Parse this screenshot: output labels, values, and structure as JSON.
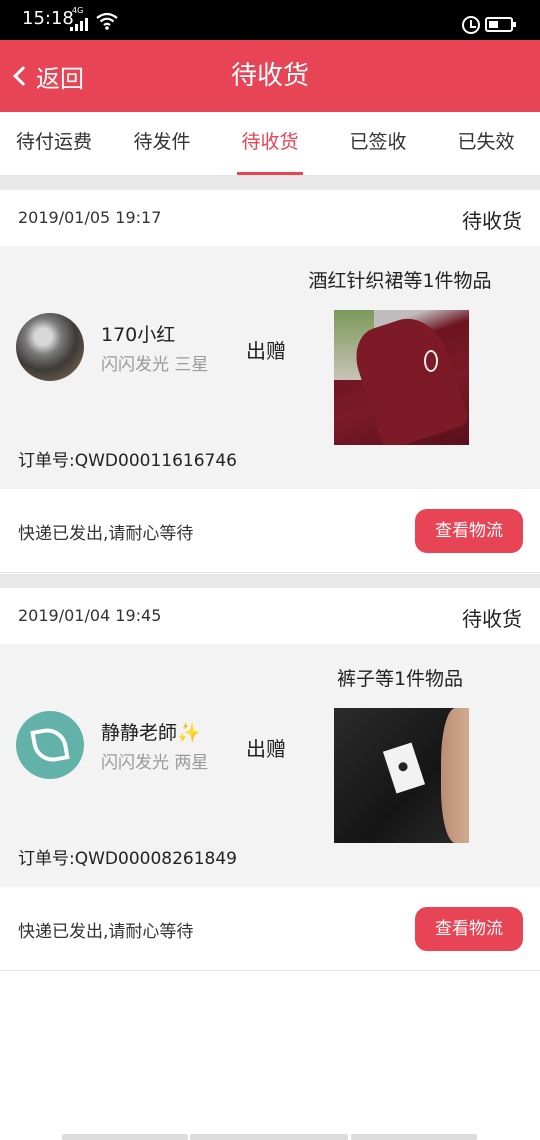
{
  "status_bar": {
    "time": "15:18",
    "network": "4G",
    "icons": [
      "signal-icon",
      "wifi-icon",
      "alarm-icon",
      "battery-icon"
    ]
  },
  "header": {
    "back_label": "返回",
    "title": "待收货",
    "bg_color": "#e74456"
  },
  "tabs": [
    {
      "label": "待付运费",
      "active": false
    },
    {
      "label": "待发件",
      "active": false
    },
    {
      "label": "待收货",
      "active": true
    },
    {
      "label": "已签收",
      "active": false
    },
    {
      "label": "已失效",
      "active": false
    }
  ],
  "orders": [
    {
      "date": "2019/01/05 19:17",
      "status": "待收货",
      "user": {
        "name": "170小红",
        "level": "闪闪发光 三星"
      },
      "action": "出赠",
      "item_title": "酒红针织裙等1件物品",
      "order_label": "订单号:",
      "order_no": "QWD00011616746",
      "note": "快递已发出,请耐心等待",
      "button": "查看物流"
    },
    {
      "date": "2019/01/04 19:45",
      "status": "待收货",
      "user": {
        "name": "静静老師✨",
        "level": "闪闪发光 两星"
      },
      "action": "出赠",
      "item_title": "裤子等1件物品",
      "order_label": "订单号:",
      "order_no": "QWD00008261849",
      "note": "快递已发出,请耐心等待",
      "button": "查看物流"
    }
  ],
  "accent_color": "#e74456"
}
